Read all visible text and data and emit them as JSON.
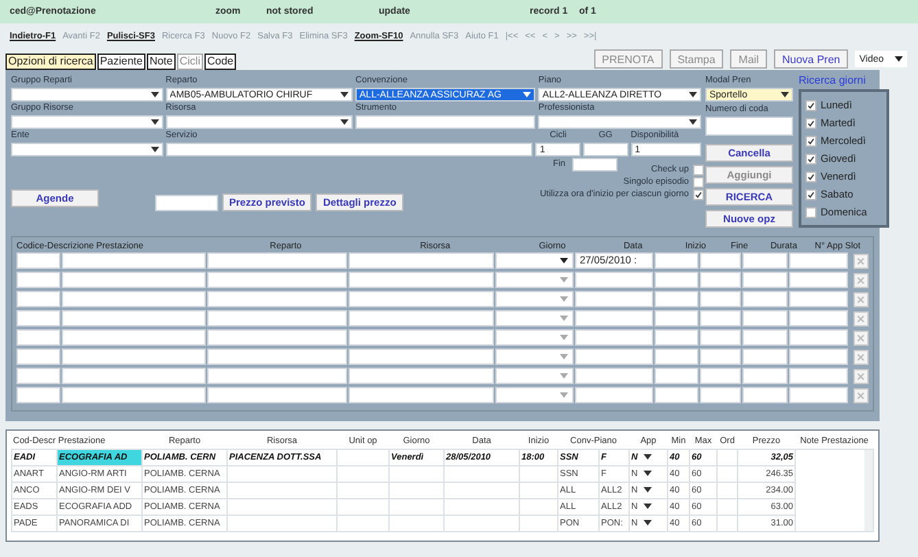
{
  "status_bar": {
    "user": "ced@Prenotazione",
    "zoom": "zoom",
    "stored": "not stored",
    "mode": "update",
    "record": "record 1",
    "of": "of 1"
  },
  "toolbar": [
    {
      "label": "Indietro-F1",
      "disabled": false
    },
    {
      "label": "Avanti F2",
      "disabled": true
    },
    {
      "label": "Pulisci-SF3",
      "disabled": false
    },
    {
      "label": "Ricerca F3",
      "disabled": true
    },
    {
      "label": "Nuovo F2",
      "disabled": true
    },
    {
      "label": "Salva F3",
      "disabled": true
    },
    {
      "label": "Elimina SF3",
      "disabled": true
    },
    {
      "label": "Zoom-SF10",
      "disabled": false
    },
    {
      "label": "Annulla SF3",
      "disabled": true
    },
    {
      "label": "Aiuto F1",
      "disabled": true
    },
    {
      "label": "|<<",
      "disabled": true
    },
    {
      "label": "<<",
      "disabled": true
    },
    {
      "label": "<",
      "disabled": true
    },
    {
      "label": ">",
      "disabled": true
    },
    {
      "label": ">>",
      "disabled": true
    },
    {
      "label": ">>|",
      "disabled": true
    }
  ],
  "tabs": [
    {
      "label": "Opzioni di ricerca",
      "selected": true,
      "disabled": false
    },
    {
      "label": "Paziente",
      "selected": false,
      "disabled": false
    },
    {
      "label": "Note",
      "selected": false,
      "disabled": false
    },
    {
      "label": "Cicli",
      "selected": false,
      "disabled": true
    },
    {
      "label": "Code",
      "selected": false,
      "disabled": false
    }
  ],
  "actions": [
    {
      "label": "PRENOTA",
      "disabled": true
    },
    {
      "label": "Stampa",
      "disabled": true
    },
    {
      "label": "Mail",
      "disabled": true
    },
    {
      "label": "Nuova Pren",
      "disabled": false
    }
  ],
  "view_select": {
    "value": "Video"
  },
  "form": {
    "rows": [
      [
        {
          "label": "Gruppo Reparti",
          "kind": "select"
        },
        {
          "label": "Reparto",
          "kind": "select",
          "value": "AMB05-AMBULATORIO CHIRUF"
        },
        {
          "label": "Convenzione",
          "kind": "select",
          "value": "ALL-ALLEANZA ASSICURAZ AG",
          "highlighted": true
        },
        {
          "label": "Piano",
          "kind": "select",
          "value": "ALL2-ALLEANZA DIRETTO"
        }
      ],
      [
        {
          "label": "Gruppo Risorse",
          "kind": "select"
        },
        {
          "label": "Risorsa",
          "kind": "select"
        },
        {
          "label": "Strumento",
          "kind": "text"
        },
        {
          "label": "Professionista",
          "kind": "select"
        }
      ]
    ],
    "ente": {
      "label": "Ente"
    },
    "servizio": {
      "label": "Servizio"
    },
    "cicli": {
      "label": "Cicli",
      "value": "1"
    },
    "gg": {
      "label": "GG"
    },
    "disponibilita": {
      "label": "Disponibilità",
      "value": "1"
    },
    "fin": {
      "label": "Fin"
    },
    "options": [
      {
        "label": "Check up",
        "checked": false
      },
      {
        "label": "Singolo episodio",
        "checked": false
      },
      {
        "label": "Utilizza ora d'inizio per ciascun giorno",
        "checked": true
      }
    ]
  },
  "side": {
    "modal_label": "Modal Pren",
    "modal_value": "Sportello",
    "queue_label": "Numero di coda",
    "buttons": [
      {
        "label": "Cancella",
        "disabled": false
      },
      {
        "label": "Aggiungi",
        "disabled": true
      },
      {
        "label": "RICERCA",
        "disabled": false
      },
      {
        "label": "Nuove opz",
        "disabled": false
      }
    ]
  },
  "days": {
    "title": "Ricerca giorni",
    "items": [
      {
        "label": "Lunedì",
        "checked": true
      },
      {
        "label": "Martedì",
        "checked": true
      },
      {
        "label": "Mercoledì",
        "checked": true
      },
      {
        "label": "Giovedì",
        "checked": true
      },
      {
        "label": "Venerdì",
        "checked": true
      },
      {
        "label": "Sabato",
        "checked": true
      },
      {
        "label": "Domenica",
        "checked": false
      }
    ]
  },
  "agende_button": "Agende",
  "price_buttons": [
    "Prezzo previsto",
    "Dettagli prezzo"
  ],
  "slot_grid": {
    "columns": [
      "Codice-Descrizione Prestazione",
      "Reparto",
      "Risorsa",
      "Giorno",
      "Data",
      "Inizio",
      "Fine",
      "Durata",
      "N° App Slot"
    ],
    "rows": [
      {
        "data": "27/05/2010 :",
        "active": true
      },
      {
        "active": false
      },
      {
        "active": false
      },
      {
        "active": false
      },
      {
        "active": false
      },
      {
        "active": false
      },
      {
        "active": false
      },
      {
        "active": false
      }
    ]
  },
  "services": {
    "columns": [
      "Cod-Descr Prestazione",
      "Reparto",
      "Risorsa",
      "Unit op",
      "Giorno",
      "Data",
      "Inizio",
      "Conv-Piano",
      "App",
      "Min",
      "Max",
      "Ord",
      "Prezzo",
      "Note Prestazione"
    ],
    "rows": [
      {
        "selected": true,
        "cod": "EADI",
        "descr": "ECOGRAFIA AD",
        "reparto": "POLIAMB. CERN",
        "risorsa": "PIACENZA DOTT.SSA",
        "giorno": "Venerdì",
        "data": "28/05/2010",
        "inizio": "18:00",
        "conv": "SSN",
        "piano": "F",
        "app": "N",
        "min": "40",
        "max": "60",
        "prezzo": "32,05"
      },
      {
        "selected": false,
        "cod": "ANART",
        "descr": "ANGIO-RM ARTI",
        "reparto": "POLIAMB. CERNA",
        "conv": "SSN",
        "piano": "F",
        "app": "N",
        "min": "40",
        "max": "60",
        "prezzo": "246.35"
      },
      {
        "selected": false,
        "cod": "ANCO",
        "descr": "ANGIO-RM DEI V",
        "reparto": "POLIAMB. CERNA",
        "conv": "ALL",
        "piano": "ALL2",
        "app": "N",
        "min": "40",
        "max": "60",
        "prezzo": "234.00"
      },
      {
        "selected": false,
        "cod": "EADS",
        "descr": "ECOGRAFIA ADD",
        "reparto": "POLIAMB. CERNA",
        "conv": "ALL",
        "piano": "ALL2",
        "app": "N",
        "min": "40",
        "max": "60",
        "prezzo": "63.00"
      },
      {
        "selected": false,
        "cod": "PADE",
        "descr": "PANORAMICA DI",
        "reparto": "POLIAMB. CERNA",
        "conv": "PON",
        "piano": "PON:",
        "app": "N",
        "min": "40",
        "max": "60",
        "prezzo": "31.00"
      }
    ]
  }
}
